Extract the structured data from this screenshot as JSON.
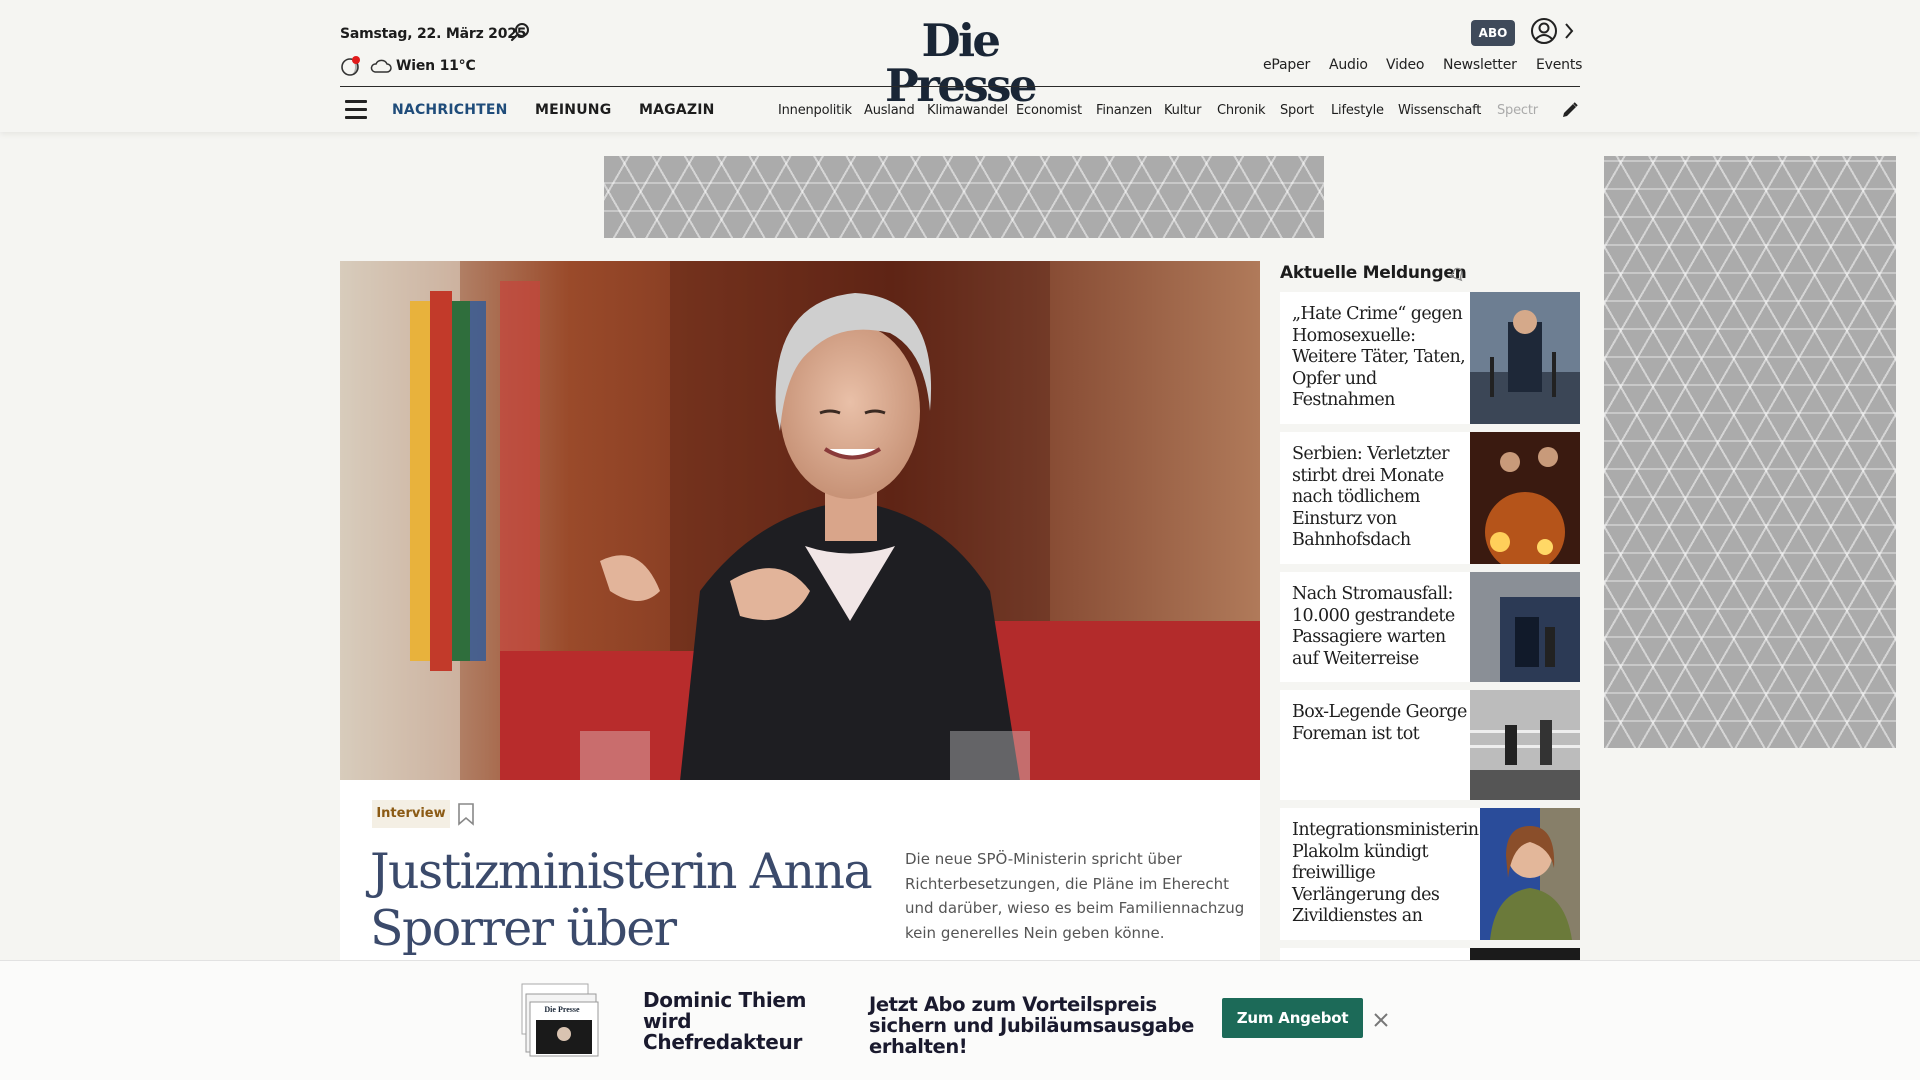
{
  "header": {
    "date": "Samstag, 22. März 2025",
    "weather": "Wien 11°C",
    "logo": "Die Presse",
    "abo": "ABO",
    "top_links": [
      "ePaper",
      "Audio",
      "Video",
      "Newsletter",
      "Events"
    ],
    "main_nav": [
      "NACHRICHTEN",
      "MEINUNG",
      "MAGAZIN"
    ],
    "sub_nav": [
      "Innenpolitik",
      "Ausland",
      "Klimawandel",
      "Economist",
      "Finanzen",
      "Kultur",
      "Chronik",
      "Sport",
      "Lifestyle",
      "Wissenschaft",
      "Spectr"
    ]
  },
  "article": {
    "tag": "Interview",
    "headline": "Justizministerin Anna Sporrer über Parteibuch",
    "teaser": "Die neue SPÖ-Ministerin spricht über Richterbesetzungen, die Pläne im Eherecht und darüber, wieso es beim Familiennachzug kein generelles Nein geben könne."
  },
  "sidebar": {
    "title": "Aktuelle Meldungen",
    "items": [
      {
        "text": "„Hate Crime“ gegen Homosexuelle: Weitere Täter, Taten, Opfer und Festnahmen"
      },
      {
        "text": "Serbien: Verletzter stirbt drei Monate nach tödlichem Einsturz von Bahnhofsdach"
      },
      {
        "text": "Nach Stromausfall: 10.000 gestrandete Passagiere warten auf Weiterreise"
      },
      {
        "text": "Box-Legende George Foreman ist tot"
      },
      {
        "text": "Integrationsministerin Plakolm kündigt freiwillige Verlängerung des Zivildienstes an"
      }
    ]
  },
  "banner": {
    "title": "Dominic Thiem wird Chefredakteur",
    "text": "Jetzt Abo zum Vorteilspreis sichern und Jubiläumsausgabe erhalten!",
    "cta": "Zum Angebot",
    "paper_logo": "Die Presse"
  },
  "colors": {
    "nav_active": "#1f4c7a",
    "headline": "#3b4a6b",
    "cta": "#1c6a58",
    "abo_bg": "#3f4a5a",
    "tag_text": "#8b5a14"
  },
  "icons": [
    "search-icon",
    "moon-icon",
    "cloud-icon",
    "user-icon",
    "chevron-right-icon",
    "menu-icon",
    "pencil-icon",
    "bookmark-icon",
    "bell-icon",
    "close-icon"
  ]
}
